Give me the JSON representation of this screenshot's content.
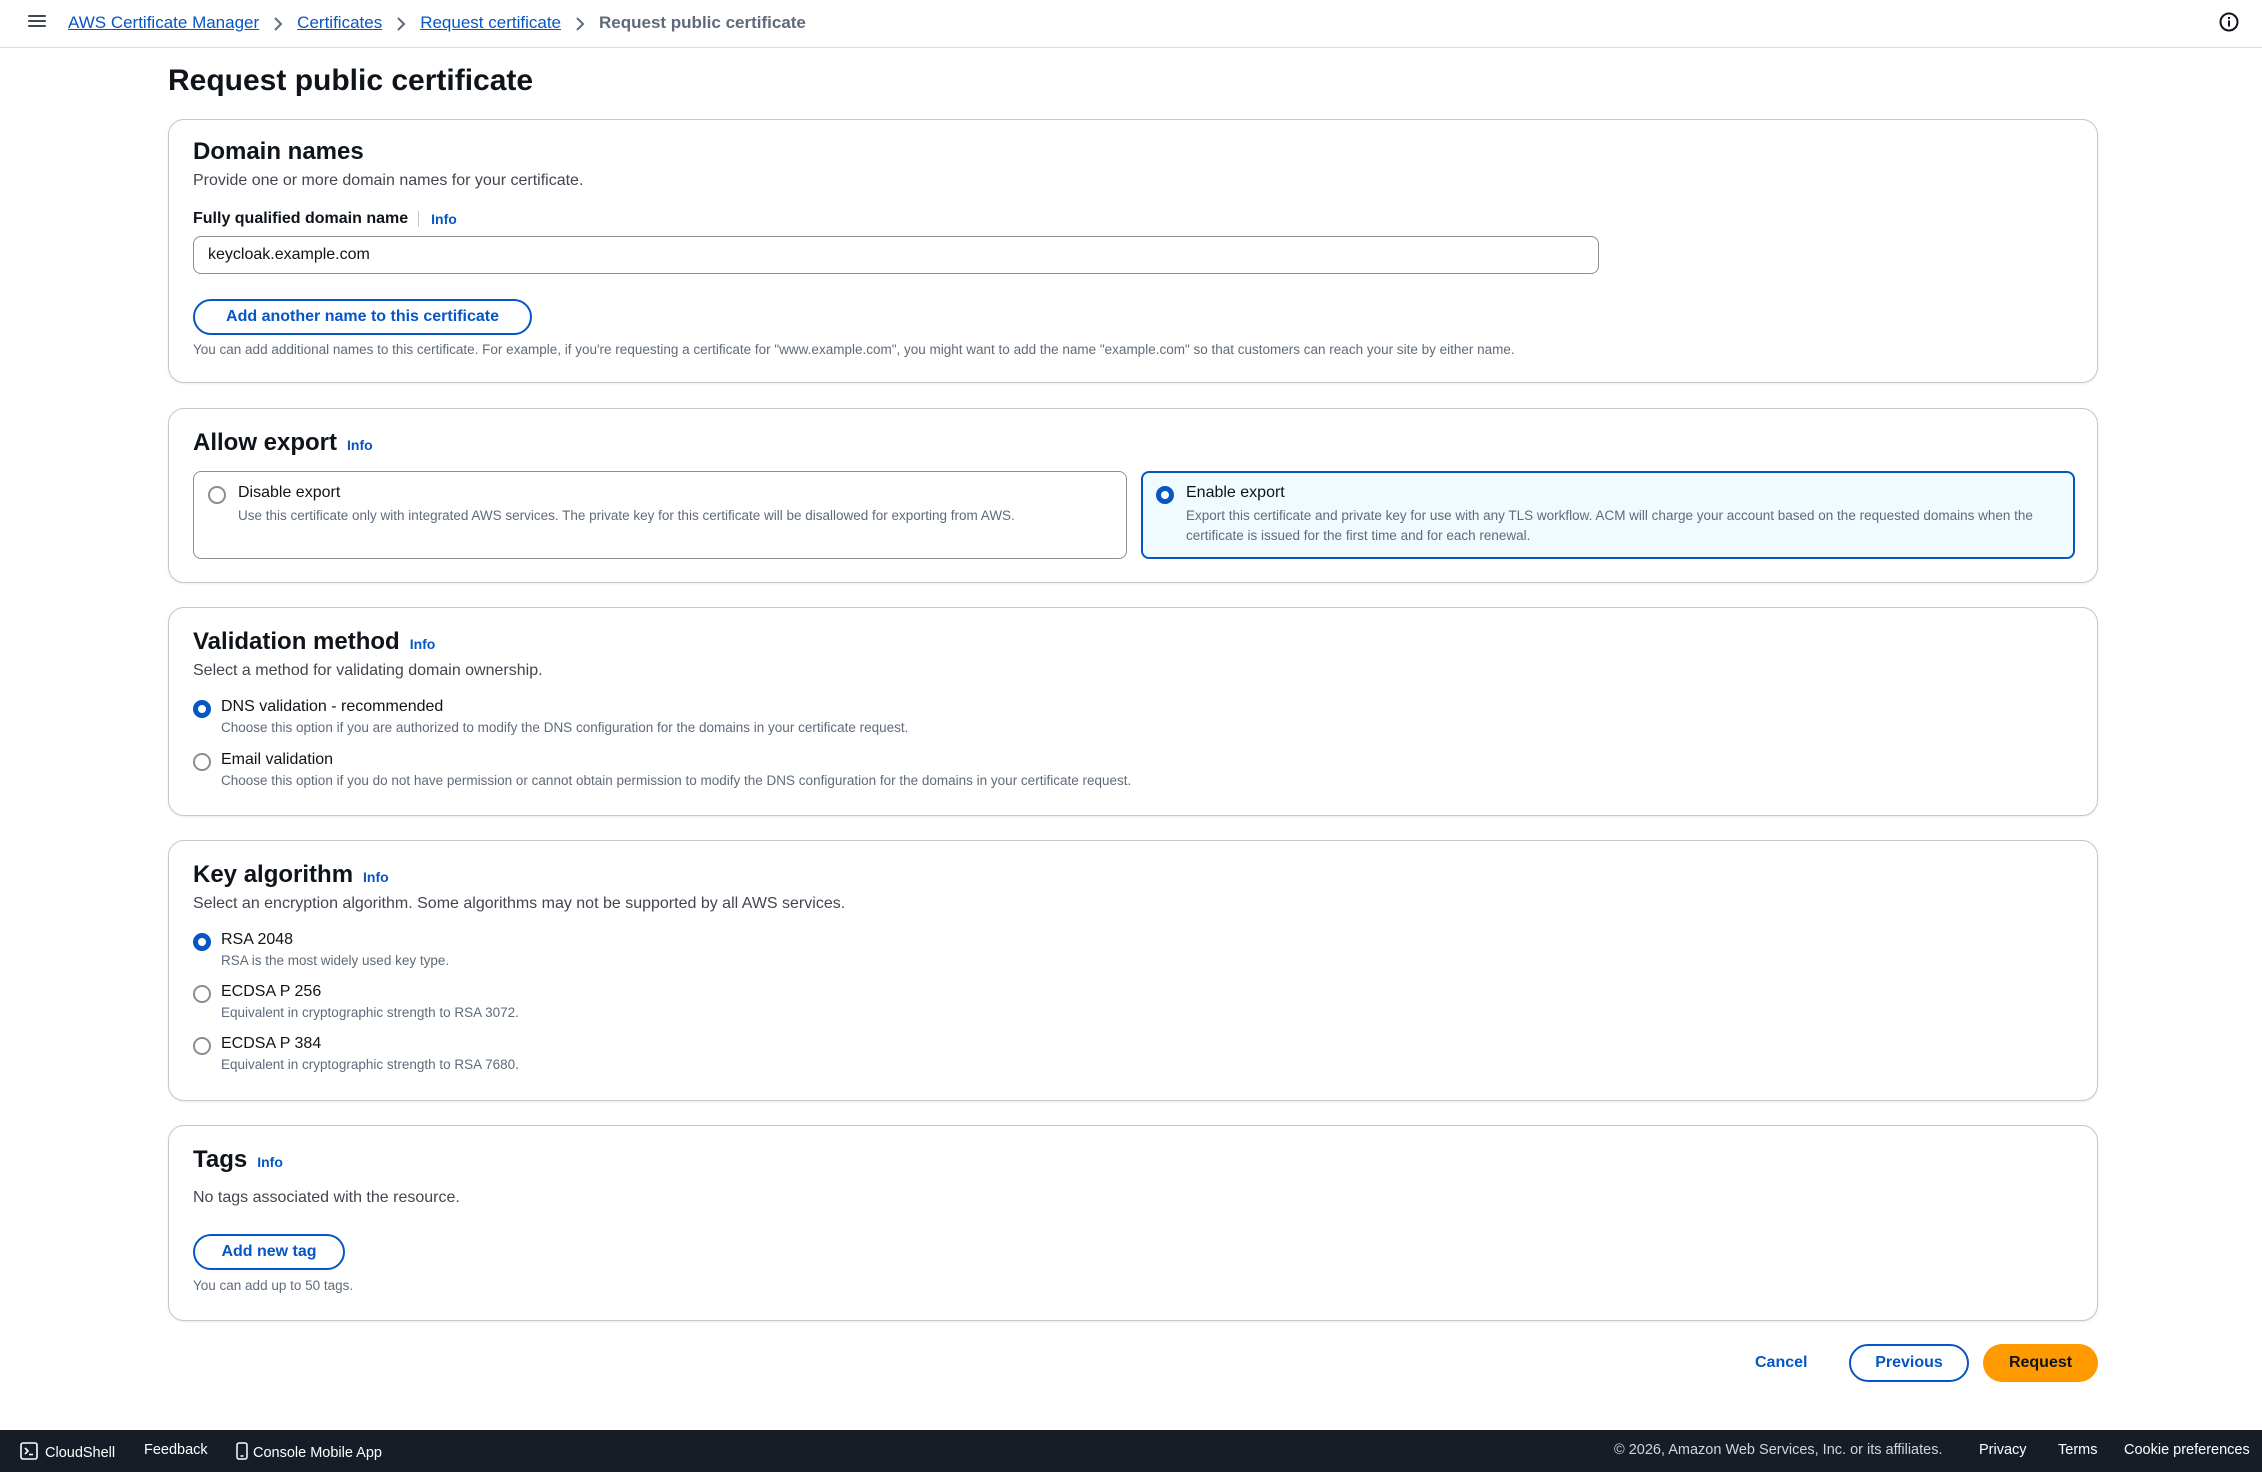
{
  "breadcrumb": {
    "items": [
      "AWS Certificate Manager",
      "Certificates",
      "Request certificate"
    ],
    "current": "Request public certificate"
  },
  "page": {
    "title": "Request public certificate"
  },
  "domain_names": {
    "heading": "Domain names",
    "description": "Provide one or more domain names for your certificate.",
    "field_label": "Fully qualified domain name",
    "info": "Info",
    "value": "keycloak.example.com",
    "add_button": "Add another name to this certificate",
    "hint": "You can add additional names to this certificate. For example, if you're requesting a certificate for \"www.example.com\", you might want to add the name \"example.com\" so that customers can reach your site by either name."
  },
  "allow_export": {
    "heading": "Allow export",
    "info": "Info",
    "options": [
      {
        "title": "Disable export",
        "description": "Use this certificate only with integrated AWS services. The private key for this certificate will be disallowed for exporting from AWS.",
        "selected": false
      },
      {
        "title": "Enable export",
        "description": "Export this certificate and private key for use with any TLS workflow. ACM will charge your account based on the requested domains when the certificate is issued for the first time and for each renewal.",
        "selected": true
      }
    ]
  },
  "validation": {
    "heading": "Validation method",
    "info": "Info",
    "description": "Select a method for validating domain ownership.",
    "options": [
      {
        "title": "DNS validation - recommended",
        "description": "Choose this option if you are authorized to modify the DNS configuration for the domains in your certificate request.",
        "selected": true
      },
      {
        "title": "Email validation",
        "description": "Choose this option if you do not have permission or cannot obtain permission to modify the DNS configuration for the domains in your certificate request.",
        "selected": false
      }
    ]
  },
  "key_algorithm": {
    "heading": "Key algorithm",
    "info": "Info",
    "description": "Select an encryption algorithm. Some algorithms may not be supported by all AWS services.",
    "options": [
      {
        "title": "RSA 2048",
        "description": "RSA is the most widely used key type.",
        "selected": true
      },
      {
        "title": "ECDSA P 256",
        "description": "Equivalent in cryptographic strength to RSA 3072.",
        "selected": false
      },
      {
        "title": "ECDSA P 384",
        "description": "Equivalent in cryptographic strength to RSA 7680.",
        "selected": false
      }
    ]
  },
  "tags": {
    "heading": "Tags",
    "info": "Info",
    "empty": "No tags associated with the resource.",
    "add_button": "Add new tag",
    "hint": "You can add up to 50 tags."
  },
  "actions": {
    "cancel": "Cancel",
    "previous": "Previous",
    "request": "Request"
  },
  "footer": {
    "cloudshell": "CloudShell",
    "feedback": "Feedback",
    "mobile_app": "Console Mobile App",
    "copyright": "© 2026, Amazon Web Services, Inc. or its affiliates.",
    "privacy": "Privacy",
    "terms": "Terms",
    "cookies": "Cookie preferences"
  },
  "colors": {
    "link": "#0656c5",
    "primary": "#ff9900",
    "footer_bg": "#161d26",
    "selected_tile_bg": "#f0fbff"
  }
}
